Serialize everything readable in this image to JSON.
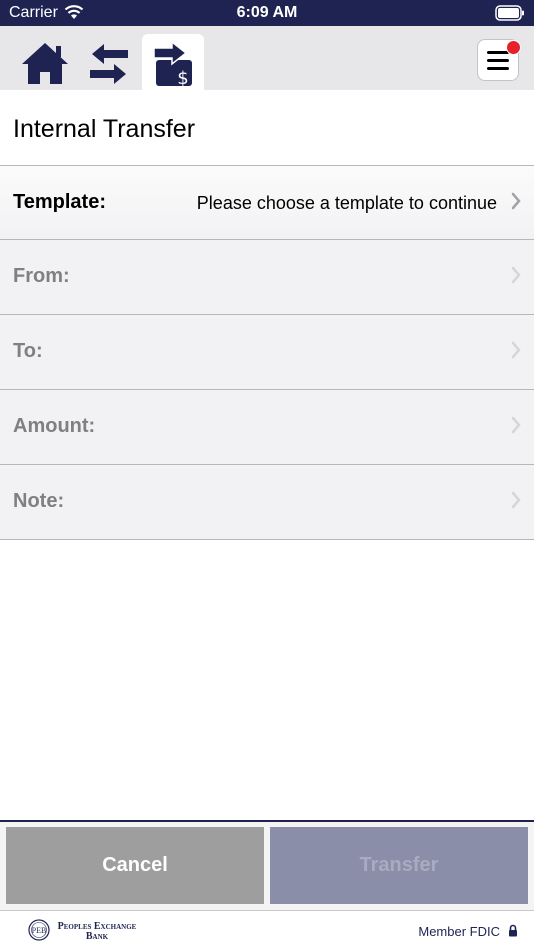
{
  "status_bar": {
    "carrier": "Carrier",
    "time": "6:09 AM"
  },
  "nav": {
    "tabs": [
      {
        "icon": "home-icon"
      },
      {
        "icon": "transfer-arrows-icon"
      },
      {
        "icon": "transfer-money-icon",
        "active": true
      }
    ],
    "menu_icon": "hamburger-menu-icon",
    "has_notification": true
  },
  "page": {
    "title": "Internal Transfer"
  },
  "form": {
    "template": {
      "label": "Template:",
      "value": "Please choose a template to continue"
    },
    "from": {
      "label": "From:",
      "value": ""
    },
    "to": {
      "label": "To:",
      "value": ""
    },
    "amount": {
      "label": "Amount:",
      "value": ""
    },
    "note": {
      "label": "Note:",
      "value": ""
    }
  },
  "actions": {
    "cancel_label": "Cancel",
    "transfer_label": "Transfer"
  },
  "footer": {
    "bank_line1": "Peoples Exchange",
    "bank_line2": "Bank",
    "fdic": "Member FDIC"
  },
  "colors": {
    "brand_navy": "#1e2352",
    "cancel_gray": "#9e9e9e",
    "transfer_disabled": "#8b8ea9",
    "notification_red": "#e8202a"
  }
}
